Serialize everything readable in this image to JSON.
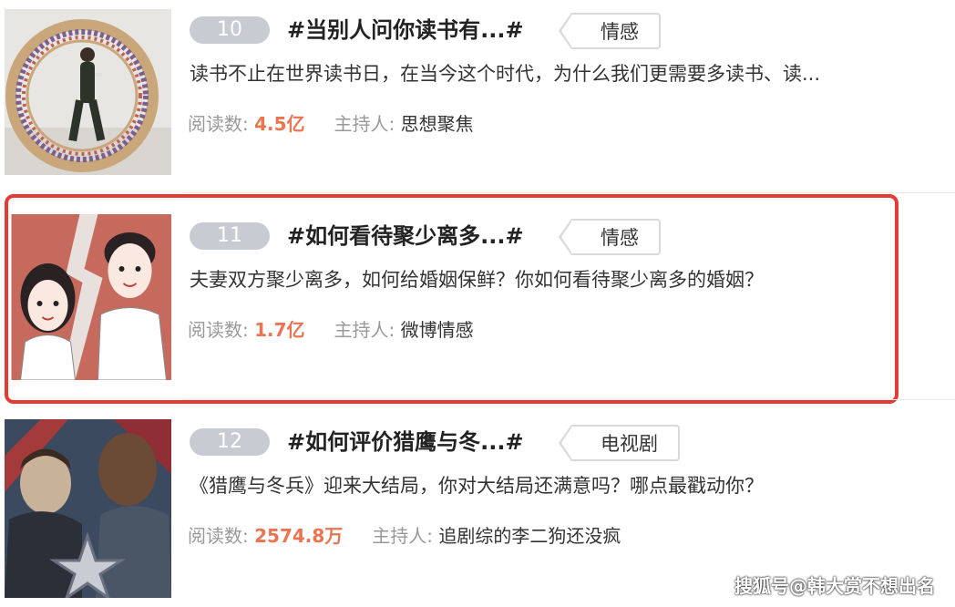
{
  "items": [
    {
      "rank": "10",
      "title": "#当别人问你读书有...#",
      "tag": "情感",
      "description": "读书不止在世界读书日，在当今这个时代，为什么我们更需要多读书、读...",
      "read_label": "阅读数: ",
      "read_count": "4.5亿",
      "host_label": "主持人: ",
      "host": "思想聚焦",
      "thumb_icon": "man-reading-in-book-wheel-image"
    },
    {
      "rank": "11",
      "title": "#如何看待聚少离多...#",
      "tag": "情感",
      "description": "夫妻双方聚少离多，如何给婚姻保鲜？你如何看待聚少离多的婚姻？",
      "read_label": "阅读数: ",
      "read_count": "1.7亿",
      "host_label": "主持人: ",
      "host": "微博情感",
      "thumb_icon": "couple-illustration-image"
    },
    {
      "rank": "12",
      "title": "#如何评价猎鹰与冬...#",
      "tag": "电视剧",
      "description": "《猎鹰与冬兵》迎来大结局，你对大结局还满意吗？哪点最戳动你？",
      "read_label": "阅读数: ",
      "read_count": "2574.8万",
      "host_label": "主持人: ",
      "host": "追剧综的李二狗还没疯",
      "thumb_icon": "falcon-winter-soldier-poster-image"
    }
  ],
  "watermark": "搜狐号@韩大赏不想出名",
  "colors": {
    "highlight_border": "#e53a35",
    "read_count": "#eb7350",
    "rank_badge": "#c9cbd2"
  }
}
